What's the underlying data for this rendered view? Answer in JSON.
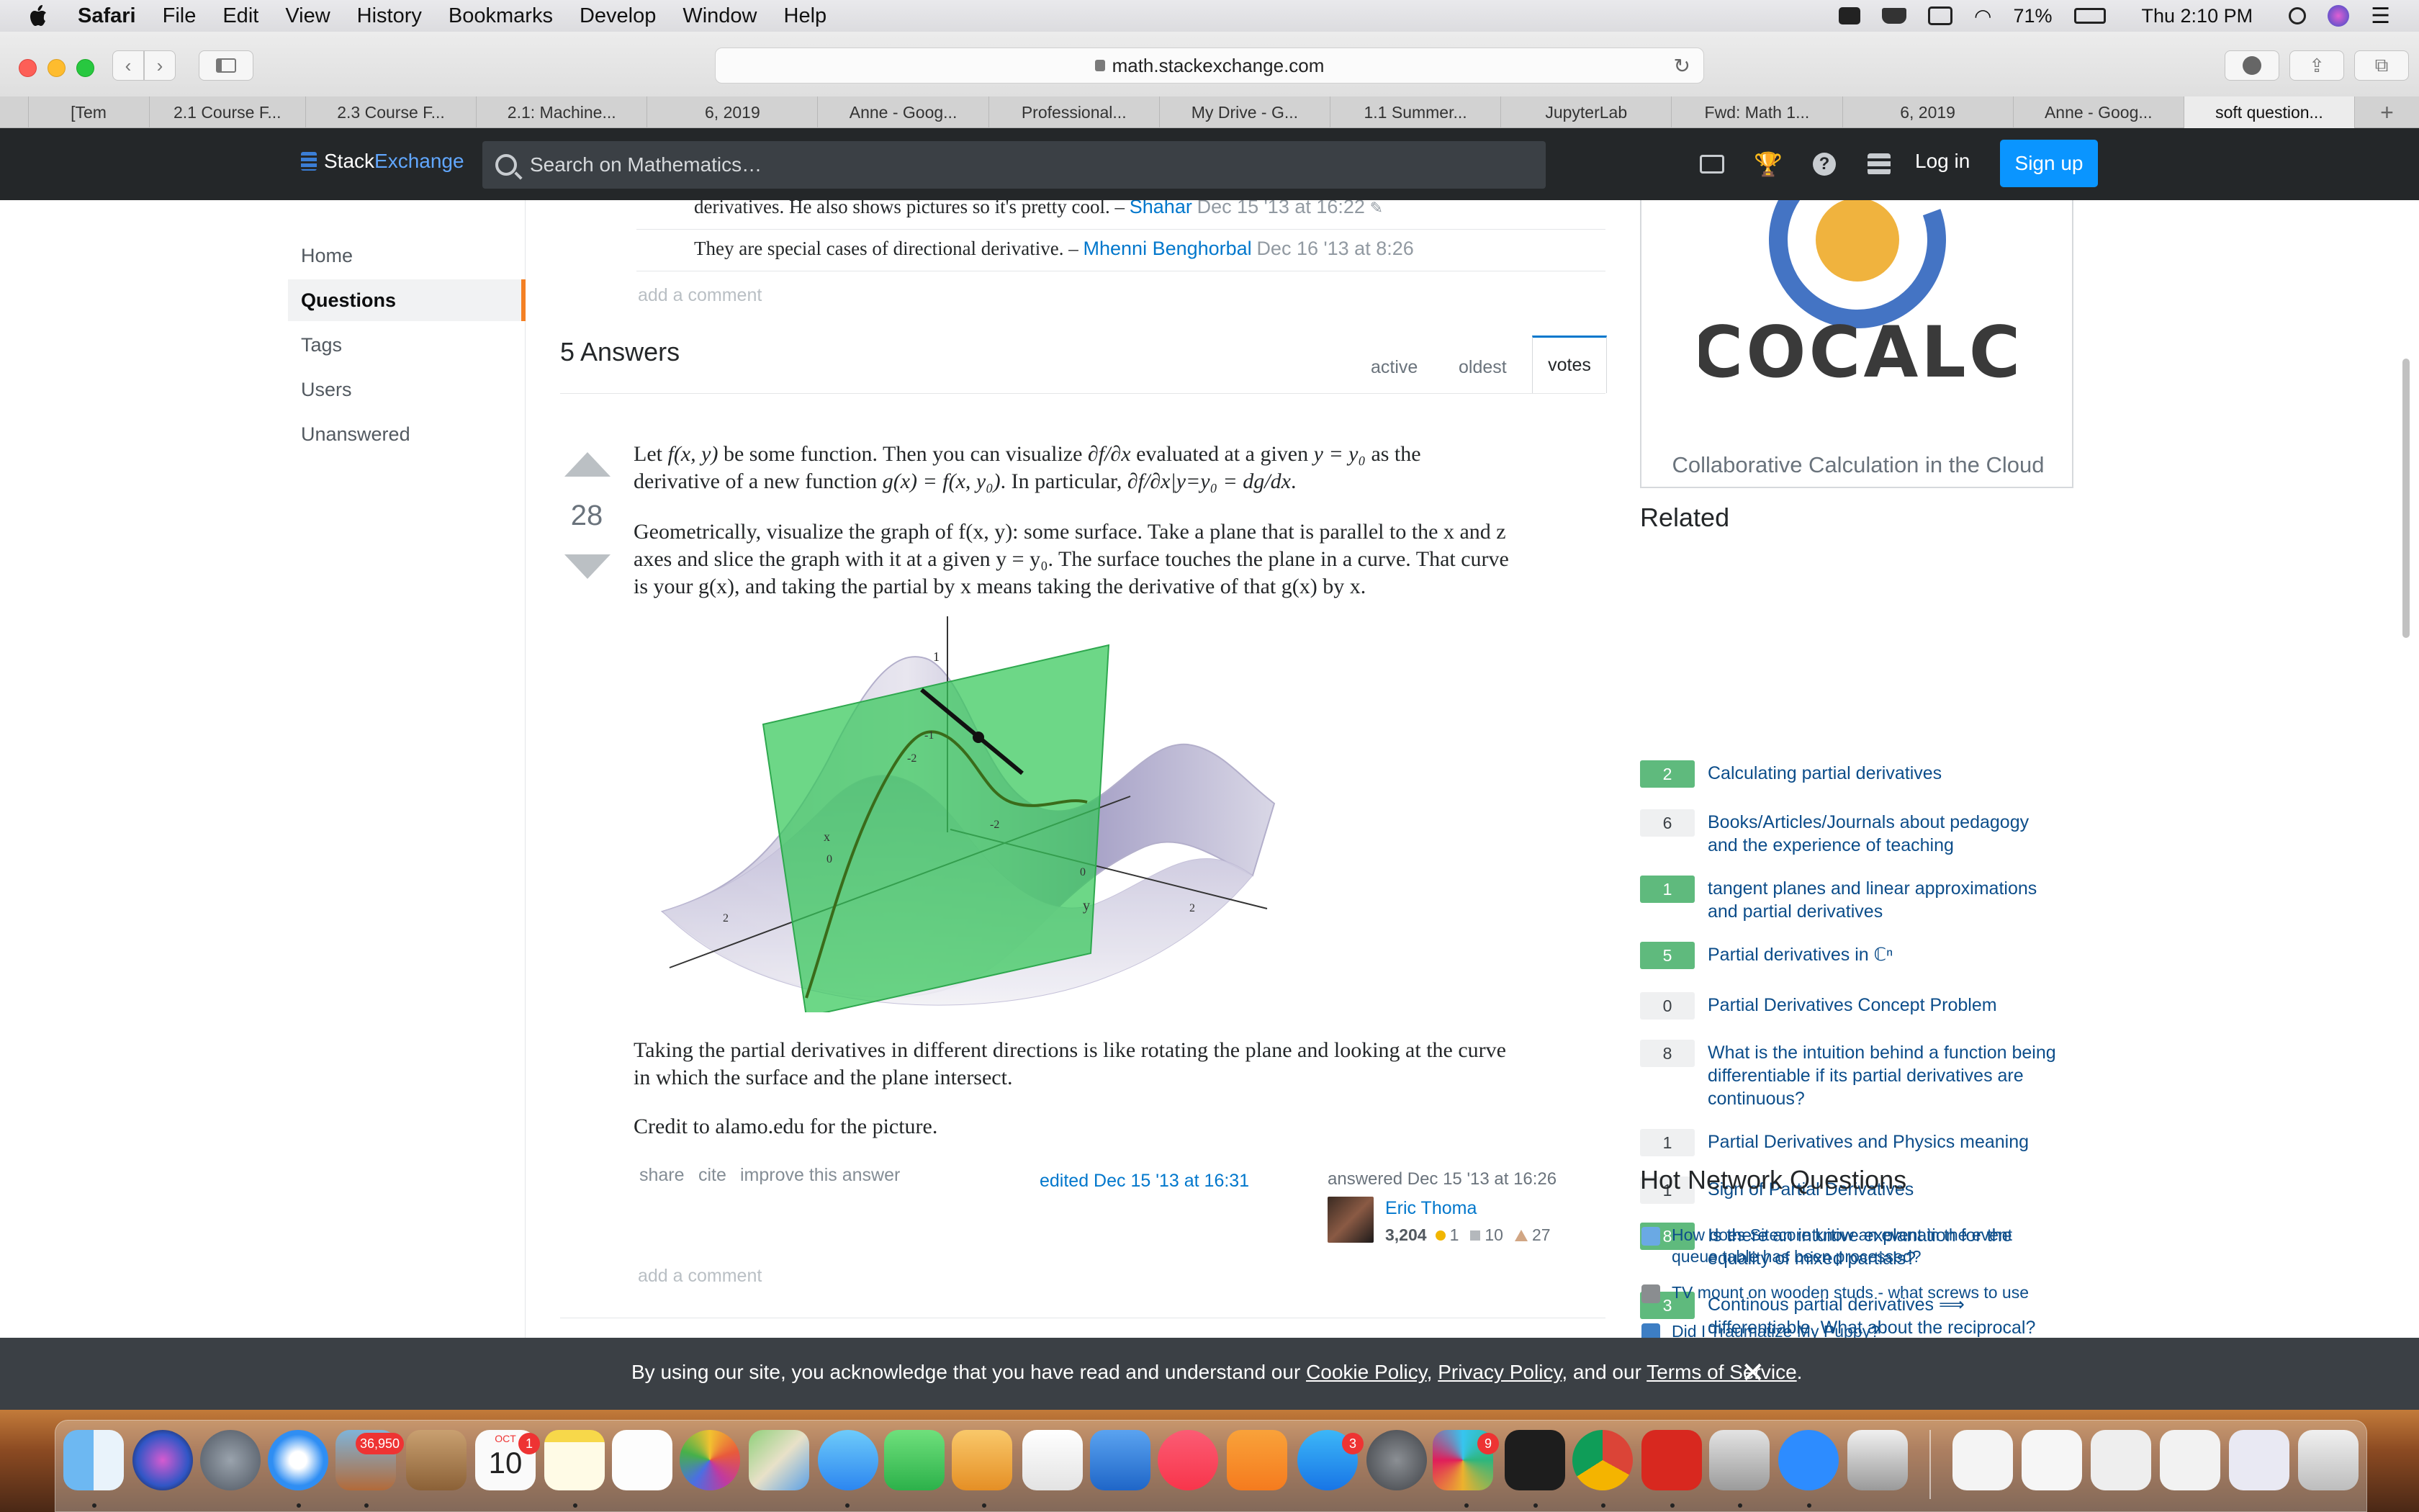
{
  "menubar": {
    "items": [
      "Safari",
      "File",
      "Edit",
      "View",
      "History",
      "Bookmarks",
      "Develop",
      "Window",
      "Help"
    ],
    "battery": "71%",
    "clock": "Thu 2:10 PM"
  },
  "browser": {
    "url": "math.stackexchange.com",
    "tabs": [
      "[Tem",
      "2.1 Course F...",
      "2.3 Course F...",
      "2.1: Machine...",
      "6, 2019",
      "Anne - Goog...",
      "Professional...",
      "My Drive - G...",
      "1.1 Summer...",
      "JupyterLab",
      "Fwd: Math 1...",
      "6, 2019",
      "Anne - Goog...",
      "soft question..."
    ],
    "active_tab_index": 13
  },
  "site_header": {
    "logo_a": "Stack",
    "logo_b": "Exchange",
    "search_placeholder": "Search on Mathematics…",
    "login": "Log in",
    "signup": "Sign up"
  },
  "leftnav": {
    "items": [
      "Home",
      "Questions",
      "Tags",
      "Users",
      "Unanswered"
    ],
    "active": "Questions"
  },
  "comments": [
    {
      "text": "derivatives. He also shows pictures so it's pretty cool. – ",
      "user": "Shahar",
      "date": "Dec 15 '13 at 16:22"
    },
    {
      "text": "They are special cases of directional derivative. – ",
      "user": "Mhenni Benghorbal",
      "date": "Dec 16 '13 at 8:26"
    }
  ],
  "add_comment": "add a comment",
  "answers_header": "5 Answers",
  "sort_tabs": [
    "active",
    "oldest",
    "votes"
  ],
  "answer": {
    "votes": "28",
    "p1_line1_a": "Let ",
    "p1_f": "f(x, y)",
    "p1_line1_b": " be some function. Then you can visualize ",
    "p1_dfdx": "∂f/∂x",
    "p1_line1_c": " evaluated at a given ",
    "p1_yy0": "y = y₀",
    "p1_line1_d": " as the",
    "p1_line2_a": "derivative of a new function ",
    "p1_gx": "g(x) = f(x, y₀)",
    "p1_line2_b": ". In particular, ",
    "p1_eq": "∂f/∂x|y=y₀ = dg/dx",
    "p1_line2_c": ".",
    "p2_line1": "Geometrically, visualize the graph of f(x, y): some surface. Take a plane that is parallel to the x and z",
    "p2_line2": "axes and slice the graph with it at a given y = y₀. The surface touches the plane in a curve. That curve",
    "p2_line3": "is your g(x), and taking the partial by x means taking the derivative of that g(x) by x.",
    "p3_line1": "Taking the partial derivatives in different directions is like rotating the plane and looking at the curve",
    "p3_line2": "in which the surface and the plane intersect.",
    "p4": "Credit to alamo.edu for the picture.",
    "links": [
      "share",
      "cite",
      "improve this answer"
    ],
    "edited": "edited Dec 15 '13 at 16:31",
    "answered": "answered Dec 15 '13 at 16:26",
    "user": "Eric Thoma",
    "rep": "3,204",
    "gold": "1",
    "silver": "10",
    "bronze": "27",
    "figure_labels": {
      "one": "1",
      "neg_one": "-1",
      "neg_two": "-2",
      "neg_two_b": "-2",
      "x": "x",
      "zero_a": "0",
      "zero_b": "0",
      "two_a": "2",
      "two_b": "2",
      "y": "y"
    }
  },
  "sidebar": {
    "ad_logo": "COCALC",
    "ad_tagline": "Collaborative Calculation in the Cloud",
    "related_title": "Related",
    "related": [
      {
        "count": "2",
        "answered": true,
        "text": [
          "Calculating partial derivatives"
        ]
      },
      {
        "count": "6",
        "answered": false,
        "text": [
          "Books/Articles/Journals about pedagogy",
          "and the experience of teaching"
        ]
      },
      {
        "count": "1",
        "answered": true,
        "text": [
          "tangent planes and linear approximations",
          "and partial derivatives"
        ]
      },
      {
        "count": "5",
        "answered": true,
        "text": [
          "Partial derivatives in ℂⁿ"
        ]
      },
      {
        "count": "0",
        "answered": false,
        "text": [
          "Partial Derivatives Concept Problem"
        ]
      },
      {
        "count": "8",
        "answered": false,
        "text": [
          "What is the intuition behind a function being",
          "differentiable if its partial derivatives are",
          "continuous?"
        ]
      },
      {
        "count": "1",
        "answered": false,
        "text": [
          "Partial Derivatives and Physics meaning"
        ]
      },
      {
        "count": "1",
        "answered": false,
        "text": [
          "Sign of Partial Derivatives"
        ]
      },
      {
        "count": "8",
        "answered": true,
        "text": [
          "Is there an intuitive explanation for the",
          "equality of mixed partials?"
        ]
      },
      {
        "count": "3",
        "answered": true,
        "text": [
          "Continous partial derivatives  ⟹",
          "differentiable. What about the reciprocal?"
        ]
      }
    ],
    "hot_title": "Hot Network Questions",
    "hot": [
      {
        "text": [
          "How does Sitecore know an event in the event",
          "queue table has been processed?"
        ],
        "color": "#6aa9e4"
      },
      {
        "text": [
          "TV mount on wooden studs - what screws to use"
        ],
        "color": "#8a8d90"
      },
      {
        "text": [
          "Did I Traumatize My Puppy?"
        ],
        "color": "#3d7ec4"
      }
    ]
  },
  "cookie": {
    "pre": "By using our site, you acknowledge that you have read and understand our ",
    "cookie_policy": "Cookie Policy",
    "sep1": ", ",
    "privacy_policy": "Privacy Policy",
    "sep2": ", and our ",
    "terms": "Terms of Service",
    "post": ".",
    "close": "✕"
  },
  "dock": {
    "calendar_month": "OCT",
    "calendar_day": "10",
    "badges": {
      "photos_app": "36,950",
      "calendar": "1",
      "appstore": "3",
      "slack": "9"
    }
  }
}
